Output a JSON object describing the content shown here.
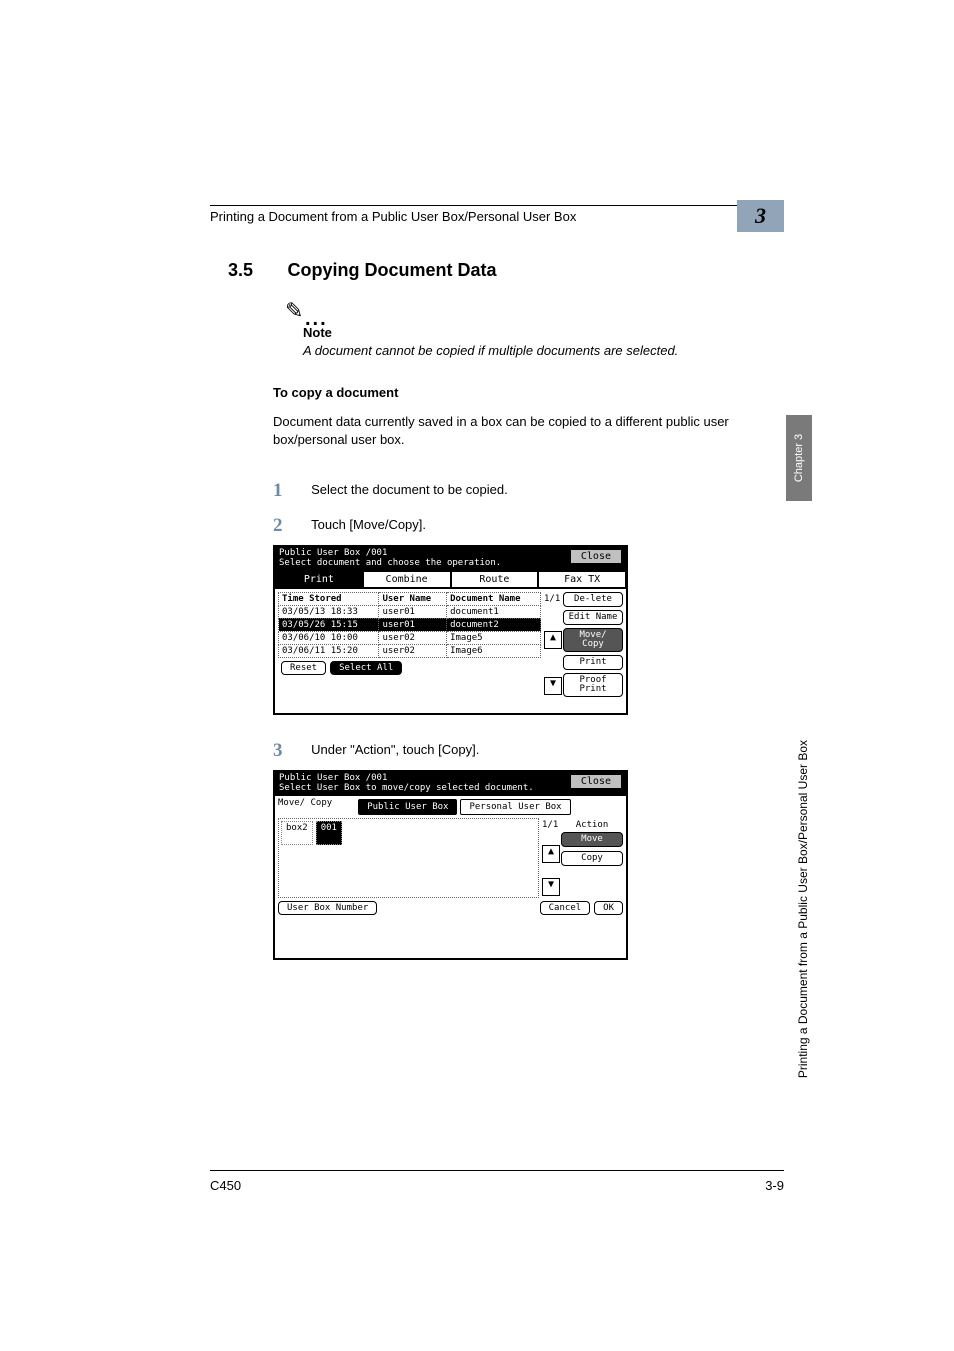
{
  "header": {
    "breadcrumb": "Printing a Document from a Public User Box/Personal User Box",
    "chapter_num": "3"
  },
  "section": {
    "number": "3.5",
    "title": "Copying Document Data"
  },
  "note": {
    "label": "Note",
    "body": "A document cannot be copied if multiple documents are selected."
  },
  "subheading": "To copy a document",
  "intro": "Document data currently saved in a box can be copied to a different public user box/personal user box.",
  "steps": {
    "1": "Select the document to be copied.",
    "2": "Touch [Move/Copy].",
    "3": "Under \"Action\", touch [Copy]."
  },
  "screenshot1": {
    "title_line1": "Public",
    "title_line2": "User Box  /001",
    "instruction": "Select document and choose the operation.",
    "close": "Close",
    "tabs": [
      "Print",
      "Combine",
      "Route",
      "Fax TX"
    ],
    "columns": {
      "time": "Time Stored",
      "user": "User Name",
      "doc": "Document Name"
    },
    "rows": [
      {
        "time": "03/05/13 18:33",
        "user": "user01",
        "doc": "document1",
        "selected": false
      },
      {
        "time": "03/05/26 15:15",
        "user": "user01",
        "doc": "document2",
        "selected": true
      },
      {
        "time": "03/06/10 10:00",
        "user": "user02",
        "doc": "Image5",
        "selected": false
      },
      {
        "time": "03/06/11 15:20",
        "user": "user02",
        "doc": "Image6",
        "selected": false
      }
    ],
    "side": [
      "De-lete",
      "Edit Name",
      "Move/ Copy",
      "Print",
      "Proof Print"
    ],
    "bottom": {
      "reset": "Reset",
      "select_all": "Select All"
    }
  },
  "screenshot2": {
    "title_line1": "Public",
    "title_line2": "User Box  /001",
    "instruction": "Select User Box to move/copy selected document.",
    "close": "Close",
    "copy_label": "Move/ Copy",
    "tabs": [
      "Public User Box",
      "Personal User Box"
    ],
    "folders": [
      {
        "name": "box2",
        "selected": false
      },
      {
        "name": "001",
        "selected": true
      }
    ],
    "action_label": "Action",
    "side": [
      "Move",
      "Copy"
    ],
    "bottom": {
      "user_box_number": "User Box Number",
      "cancel": "Cancel",
      "ok": "OK"
    }
  },
  "side_tab": "Chapter 3",
  "side_vertical": "Printing a Document from a Public User Box/Personal User Box",
  "footer": {
    "left": "C450",
    "right": "3-9"
  }
}
